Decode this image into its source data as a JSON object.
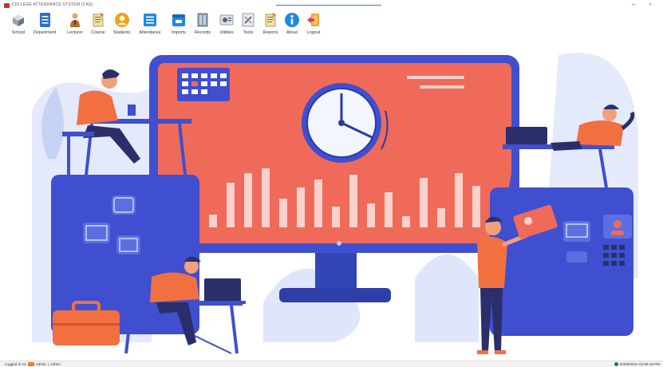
{
  "window": {
    "title": "COLLEGE ATTENDANCE SYSTEM (CAS)",
    "minimize_glyph": "–",
    "maximize_glyph": "▫"
  },
  "toolbar": {
    "items": [
      {
        "label": "School",
        "icon": "school-icon"
      },
      {
        "label": "Department",
        "icon": "department-icon"
      },
      {
        "label": "Lecturer",
        "icon": "lecturer-icon"
      },
      {
        "label": "Course",
        "icon": "course-icon"
      },
      {
        "label": "Students",
        "icon": "students-icon"
      },
      {
        "label": "Attendance",
        "icon": "attendance-icon"
      },
      {
        "label": "Imports",
        "icon": "imports-icon"
      },
      {
        "label": "Records",
        "icon": "records-icon"
      },
      {
        "label": "Utilities",
        "icon": "utilities-icon"
      },
      {
        "label": "Tools",
        "icon": "tools-icon"
      },
      {
        "label": "Reports",
        "icon": "reports-icon"
      },
      {
        "label": "About",
        "icon": "about-icon"
      },
      {
        "label": "Logout",
        "icon": "logout-icon"
      }
    ]
  },
  "status": {
    "logged_in_label": "Logged in As",
    "user_name": "Admin",
    "separator": "|",
    "user_role": "Admin",
    "datetime": "02/08/2022 02:59:18 PM"
  },
  "colors": {
    "accent_blue": "#3d5bd9",
    "screen_red": "#f06a5a",
    "orange": "#f2703f",
    "light_blue": "#c7d3f5"
  }
}
